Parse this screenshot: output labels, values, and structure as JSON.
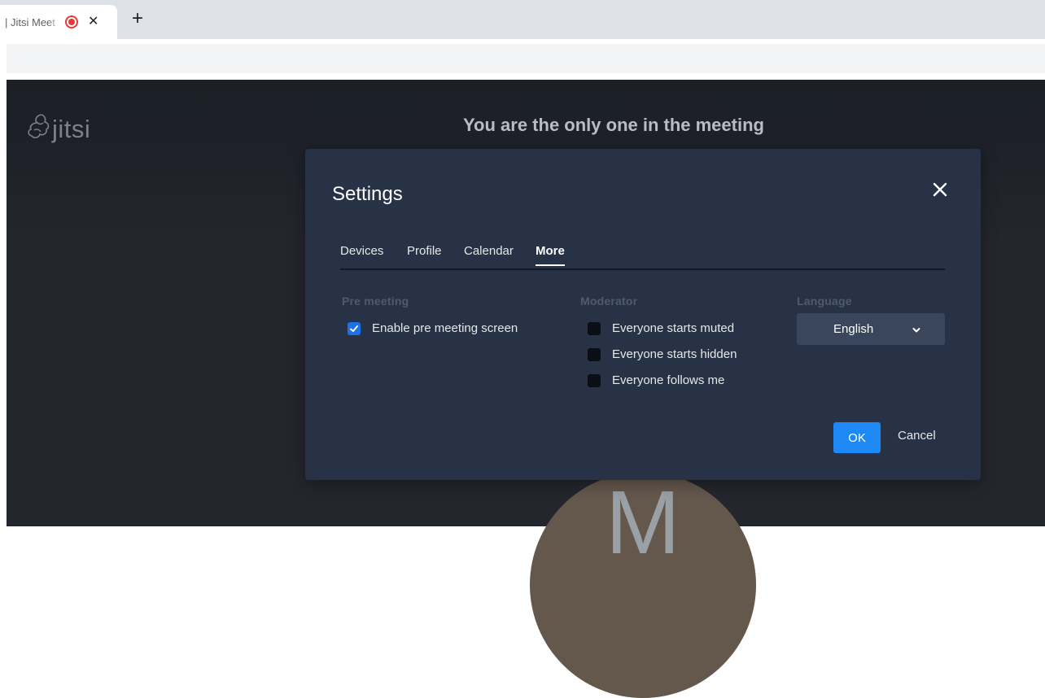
{
  "browser": {
    "tab_title": "| Jitsi Meet",
    "recording_icon": "record-icon",
    "close_icon": "close-icon",
    "new_tab_label": "+"
  },
  "app": {
    "logo_text": "jitsi",
    "meeting_status": "You are the only one in the meeting",
    "avatar_letter": "M"
  },
  "settings": {
    "title": "Settings",
    "close_icon": "close-icon",
    "tabs": [
      {
        "label": "Devices",
        "active": false
      },
      {
        "label": "Profile",
        "active": false
      },
      {
        "label": "Calendar",
        "active": false
      },
      {
        "label": "More",
        "active": true
      }
    ],
    "pre_meeting": {
      "heading": "Pre meeting",
      "options": [
        {
          "label": "Enable pre meeting screen",
          "checked": true
        }
      ]
    },
    "moderator": {
      "heading": "Moderator",
      "options": [
        {
          "label": "Everyone starts muted",
          "checked": false
        },
        {
          "label": "Everyone starts hidden",
          "checked": false
        },
        {
          "label": "Everyone follows me",
          "checked": false
        }
      ]
    },
    "language": {
      "heading": "Language",
      "selected": "English"
    },
    "ok_label": "OK",
    "cancel_label": "Cancel"
  },
  "colors": {
    "dialog_bg": "#273246",
    "primary_button": "#1e88f5",
    "checkbox_checked": "#1a73e8",
    "stage_bg": "#24262d"
  }
}
